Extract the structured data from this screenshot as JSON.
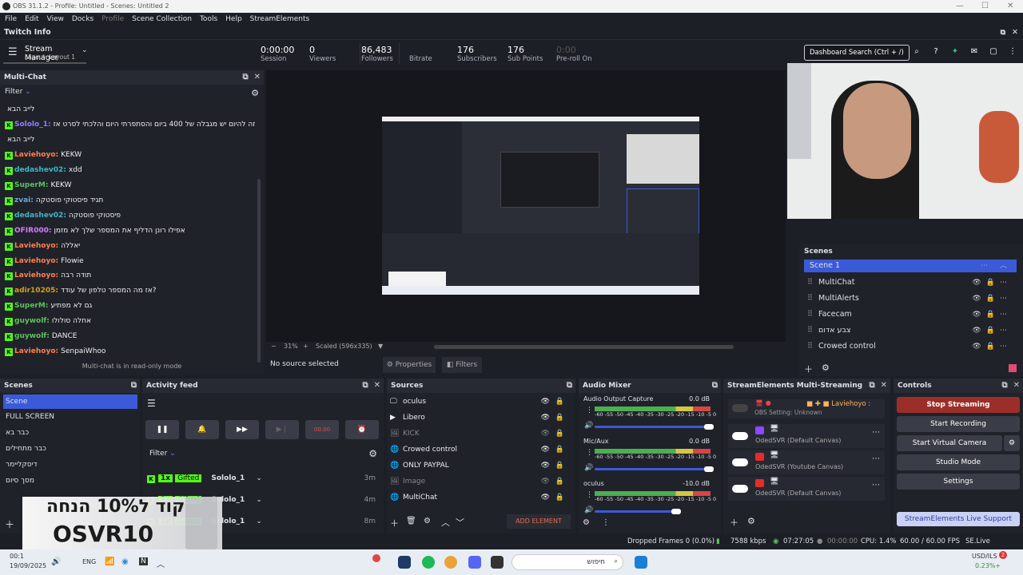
{
  "window": {
    "title": "OBS 31.1.2 - Profile: Untitled - Scenes: Untitled 2",
    "min": "—",
    "max": "☐",
    "close": "✕"
  },
  "menu": [
    "File",
    "Edit",
    "View",
    "Docks",
    "Profile",
    "Scene Collection",
    "Tools",
    "Help",
    "StreamElements"
  ],
  "twitch_info": {
    "title": "Twitch Info"
  },
  "stream_manager": {
    "title": "Stream Manager",
    "layout": "Layout: Layout 1"
  },
  "stats": [
    {
      "value": "0:00:00",
      "label": "Session"
    },
    {
      "value": "0",
      "label": "Viewers"
    },
    {
      "value": "86,483",
      "label": "Followers"
    },
    {
      "value": "",
      "label": "Bitrate"
    },
    {
      "value": "176",
      "label": "Subscribers"
    },
    {
      "value": "176",
      "label": "Sub Points"
    },
    {
      "value": "0:00",
      "label": "Pre-roll On"
    }
  ],
  "search": {
    "placeholder": "Dashboard Search (Ctrl + /)"
  },
  "multichat": {
    "title": "Multi-Chat",
    "filter": "Filter",
    "readonly": "Multi-chat is in read-only mode",
    "messages": [
      {
        "user": "",
        "text": "לייב הבא",
        "color": "#ddd",
        "badge": false
      },
      {
        "user": "Sololo_1:",
        "text": "זה להיום יש מגבלה של 400 ביום והסתפרתי היום והלכתי לסרט אז",
        "color": "#8f7cff",
        "badge": true
      },
      {
        "user": "",
        "text": "לייב הבא",
        "color": "#ddd",
        "badge": false
      },
      {
        "user": "Laviehoyo:",
        "text": "KEKW",
        "color": "#ff7f50",
        "badge": true
      },
      {
        "user": "dedashev02:",
        "text": "xdd",
        "color": "#3fb6c9",
        "badge": true
      },
      {
        "user": "SuperM:",
        "text": "KEKW",
        "color": "#5bc25b",
        "badge": true
      },
      {
        "user": "zvai:",
        "text": "תגיד פיסטוקי פוסטקה",
        "color": "#6fa8dc",
        "badge": true
      },
      {
        "user": "dedashev02:",
        "text": "פיסטוקי פוסטקה",
        "color": "#3fb6c9",
        "badge": true
      },
      {
        "user": "OFIR000:",
        "text": "אפילו רונן הדליף את המספר שלך לא מזמן",
        "color": "#d77bff",
        "badge": true
      },
      {
        "user": "Laviehoyo:",
        "text": "יאללה",
        "color": "#ff7f50",
        "badge": true
      },
      {
        "user": "Laviehoyo:",
        "text": "Flowie",
        "color": "#ff7f50",
        "badge": true
      },
      {
        "user": "Laviehoyo:",
        "text": "תודה רבה",
        "color": "#ff7f50",
        "badge": true
      },
      {
        "user": "adir10205:",
        "text": "אז מה המספר טלפון של עודד?",
        "color": "#d4a017",
        "badge": true
      },
      {
        "user": "SuperM:",
        "text": "גם לא מפתיע",
        "color": "#5bc25b",
        "badge": true
      },
      {
        "user": "guywolf:",
        "text": "אחלה סולולו",
        "color": "#5bc25b",
        "badge": true
      },
      {
        "user": "guywolf:",
        "text": "DANCE",
        "color": "#5bc25b",
        "badge": true
      },
      {
        "user": "Laviehoyo:",
        "text": "SenpaiWhoo",
        "color": "#ff7f50",
        "badge": true
      }
    ]
  },
  "preview": {
    "zoom": "31%",
    "scaled": "Scaled (596x335)",
    "no_source": "No source selected",
    "properties": "Properties",
    "filters": "Filters"
  },
  "scenes_right": {
    "title": "Scenes",
    "items": [
      "Scene 1",
      "MultiChat",
      "MultiAlerts",
      "Facecam",
      "צבע אדום",
      "Crowed control"
    ]
  },
  "scenes": {
    "title": "Scenes",
    "items": [
      "Scene",
      "FULL SCREEN",
      "כבר בא",
      "כבר מתחילים",
      "דיסקליימר",
      "מסך סיום"
    ]
  },
  "activity": {
    "title": "Activity feed",
    "filter": "Filter",
    "rec": "00:00",
    "events": [
      {
        "count": "1x",
        "type": "Gifted",
        "user": "Sololo_1",
        "time": "3m"
      },
      {
        "count": "1x",
        "type": "Gifted",
        "user": "Sololo_1",
        "time": "4m"
      },
      {
        "count": "1x",
        "type": "Gifted",
        "user": "Sololo_1",
        "time": "8m"
      }
    ]
  },
  "sources": {
    "title": "Sources",
    "add_element": "ADD ELEMENT",
    "items": [
      {
        "name": "oculus",
        "icon": "🖵"
      },
      {
        "name": "Libero",
        "icon": "▶"
      },
      {
        "name": "KICK",
        "icon": "🖼",
        "dim": true
      },
      {
        "name": "Crowed control",
        "icon": "🌐"
      },
      {
        "name": "ONLY PAYPAL",
        "icon": "🌐"
      },
      {
        "name": "Image",
        "icon": "🖼",
        "dim": true
      },
      {
        "name": "MultiChat",
        "icon": "🌐"
      }
    ]
  },
  "mixer": {
    "title": "Audio Mixer",
    "scale": "-60 -55 -50 -45 -40 -35 -30 -25 -20 -15 -10 -5 0",
    "channels": [
      {
        "name": "Audio Output Capture",
        "db": "0.0 dB"
      },
      {
        "name": "Mic/Aux",
        "db": "0.0 dB"
      },
      {
        "name": "oculus",
        "db": "-10.0 dB"
      }
    ]
  },
  "multistream": {
    "title": "StreamElements Multi-Streaming",
    "user": "Laviehoyo",
    "obs_setting": "OBS Setting: Unknown",
    "destinations": [
      {
        "name": "OdedSVR (Default Canvas)",
        "platform": "twitch"
      },
      {
        "name": "OdedSVR (Youtube Canvas)",
        "platform": "youtube"
      },
      {
        "name": "OdedSVR (Default Canvas)",
        "platform": "youtube"
      }
    ]
  },
  "controls": {
    "title": "Controls",
    "stop": "Stop Streaming",
    "record": "Start Recording",
    "virtual": "Start Virtual Camera",
    "studio": "Studio Mode",
    "settings": "Settings",
    "support": "StreamElements Live Support"
  },
  "status": {
    "dropped": "Dropped Frames 0 (0.0%)",
    "kbps": "7588 kbps",
    "live": "07:27:05",
    "rec": "00:00:00",
    "cpu": "CPU: 1.4%",
    "fps": "60.00 / 60.00 FPS",
    "version": "SE.Live 25.9.3.493"
  },
  "overlay": {
    "line1": "קוד ל10% הנחה",
    "line2": "OSVR10"
  },
  "taskbar": {
    "time": "00:1",
    "date": "19/09/2025",
    "lang": "ENG",
    "search": "חיפוש",
    "stock": "USD/ILS",
    "change": "0.23%+"
  }
}
